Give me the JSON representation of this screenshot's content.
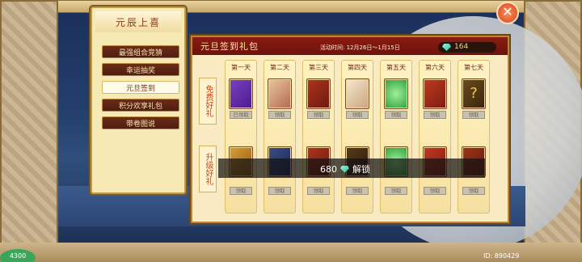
{
  "menu": {
    "title": "元辰上喜",
    "items": [
      {
        "label": "最强组合竞猜",
        "active": false
      },
      {
        "label": "幸运抽奖",
        "active": false
      },
      {
        "label": "元旦签到",
        "active": true
      },
      {
        "label": "积分欢享礼包",
        "active": false
      },
      {
        "label": "带卷图说",
        "active": false
      }
    ]
  },
  "panel": {
    "title": "元旦签到礼包",
    "time": "活动时间: 12月26日～1月15日",
    "gems": "164",
    "row_labels": [
      "免费好礼",
      "升级好礼"
    ],
    "days": [
      {
        "day": "第一天",
        "free_claim": "已领取",
        "up_claim": "领取"
      },
      {
        "day": "第二天",
        "free_claim": "领取",
        "up_claim": "领取"
      },
      {
        "day": "第三天",
        "free_claim": "领取",
        "up_claim": "领取"
      },
      {
        "day": "第四天",
        "free_claim": "领取",
        "up_claim": "领取"
      },
      {
        "day": "第五天",
        "free_claim": "领取",
        "up_claim": "领取"
      },
      {
        "day": "第六天",
        "free_claim": "领取",
        "up_claim": "领取"
      },
      {
        "day": "第七天",
        "free_claim": "领取",
        "up_claim": "领取"
      }
    ]
  },
  "unlock": {
    "cost": "680",
    "label": "解锁"
  },
  "footer": {
    "id": "ID: 890429",
    "bubble": "4300"
  },
  "close_icon": "close-icon",
  "colors": {
    "header": "#8b1c14",
    "accent": "#c74a1e",
    "gem": "#2bbf9c"
  }
}
